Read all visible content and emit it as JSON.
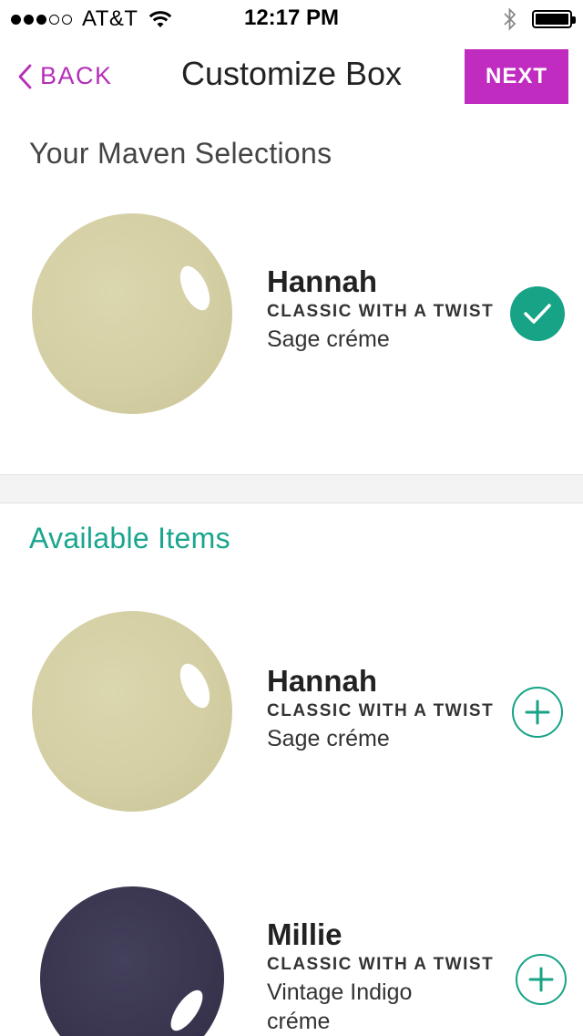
{
  "status_bar": {
    "carrier": "AT&T",
    "time": "12:17 PM",
    "signal_bars": 3,
    "signal_total": 5
  },
  "nav": {
    "back_label": "BACK",
    "title": "Customize Box",
    "next_label": "NEXT"
  },
  "selections": {
    "heading": "Your Maven Selections",
    "items": [
      {
        "name": "Hannah",
        "line": "CLASSIC WITH A TWIST",
        "finish": "Sage créme",
        "color": "#d6d2a8",
        "action": "check-icon"
      }
    ]
  },
  "available": {
    "heading": "Available Items",
    "items": [
      {
        "name": "Hannah",
        "line": "CLASSIC WITH A TWIST",
        "finish": "Sage créme",
        "color": "#d6d2a8",
        "action": "plus-icon"
      },
      {
        "name": "Millie",
        "line": "CLASSIC WITH A TWIST",
        "finish_lines": [
          "Vintage Indigo",
          "créme"
        ],
        "color": "#3a3650",
        "action": "plus-icon"
      }
    ]
  },
  "colors": {
    "accent_purple": "#c02cc0",
    "accent_green": "#16a386"
  }
}
